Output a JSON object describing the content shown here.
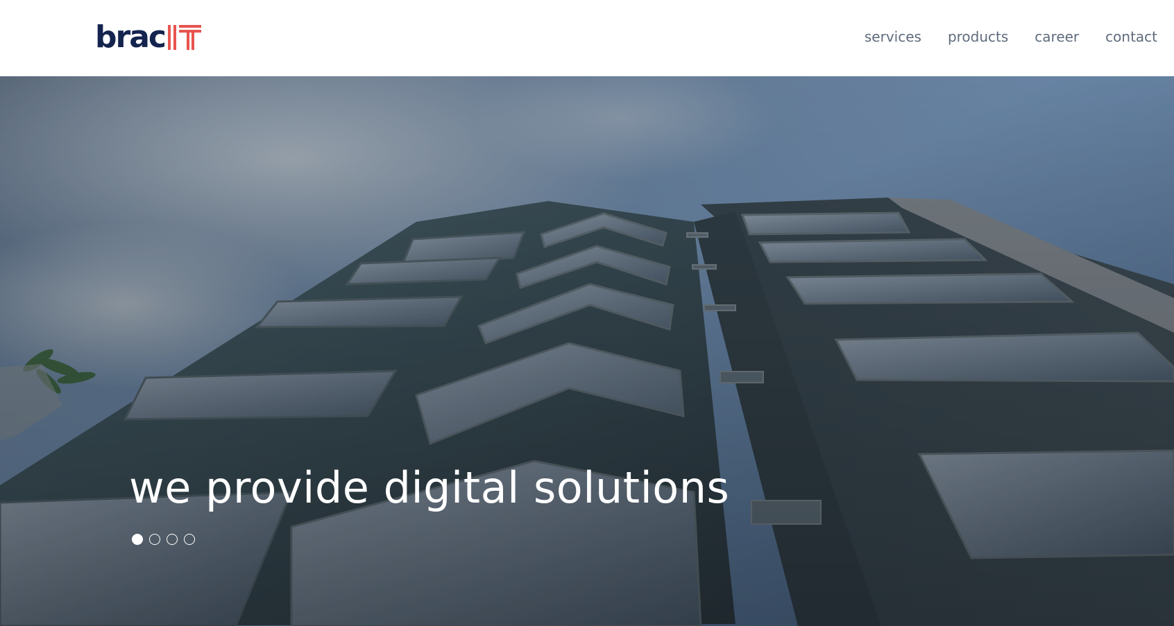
{
  "header": {
    "logo": {
      "brand_text": "brac",
      "suffix_text": "IT",
      "brand_color": "#14244f",
      "suffix_color": "#e8544f"
    },
    "nav": [
      {
        "label": "services"
      },
      {
        "label": "products"
      },
      {
        "label": "career"
      },
      {
        "label": "contact"
      }
    ]
  },
  "hero": {
    "title": "we provide digital solutions",
    "slides_total": 4,
    "active_slide": 1
  }
}
